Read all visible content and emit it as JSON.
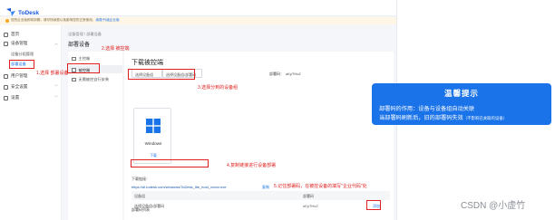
{
  "app": {
    "brand": "ToDesk",
    "brand_sub": "远程控制"
  },
  "notice": {
    "text": "您的企业版即将到期，请尽快续费以免影响您的正常使用，",
    "link": "续费/升级企业版"
  },
  "sidebar": {
    "items": [
      {
        "label": "首页",
        "icon": "home-icon"
      },
      {
        "label": "设备管理",
        "icon": "device-icon",
        "expanded": true
      },
      {
        "label": "用户管理",
        "icon": "user-icon"
      },
      {
        "label": "安全设置",
        "icon": "shield-icon"
      },
      {
        "label": "设置",
        "icon": "gear-icon"
      }
    ],
    "subitems": [
      {
        "label": "设备分组管理"
      },
      {
        "label": "部署设备"
      }
    ]
  },
  "main": {
    "breadcrumb": "设备管理  /  部署设备",
    "title": "部署设备",
    "left_items": [
      {
        "label": "主控端"
      },
      {
        "label": "被控端"
      },
      {
        "label": "无需被控自行安装"
      }
    ]
  },
  "content": {
    "title": "下载被控端",
    "dept_select": "选择设备组",
    "dept_value": "选择设备组/部署码",
    "code_label": "部署码：",
    "code_value": "uKyTHxZ",
    "platform": "Windows",
    "download_btn": "下载",
    "download_label": "下载链接：",
    "download_url": "https://dl.todesk.com/windows/ToDesk_lite_host_xxxxx.exe",
    "copy_btn": "复制",
    "history_title": "部署码列表",
    "table": {
      "headers": [
        "设备组",
        "部署码",
        "操作"
      ],
      "rows": [
        {
          "group": "选择设备组/部署码",
          "code": "uKyTHxZ",
          "action": "添加"
        }
      ]
    }
  },
  "annotations": {
    "a1": "1.选择 部署设备",
    "a2": "2.选择 被控端",
    "a3": "3.选择分到的设备组",
    "a4": "4.复制链接进行设备部署",
    "a5": "5.记住部署码，在被控设备的填写\"企业代码\"处"
  },
  "tip": {
    "title": "温馨提示",
    "line1": "部署码的作用：设备与设备组自动关联",
    "line2": "当部署码刷新后，旧的部署码失效",
    "line2_note": "（不影响已关联的设备）"
  },
  "watermark": "CSDN @小虚竹",
  "colors": {
    "accent": "#1a73e8",
    "annotation": "#e02020",
    "tip_bg": "#1a73e8"
  }
}
